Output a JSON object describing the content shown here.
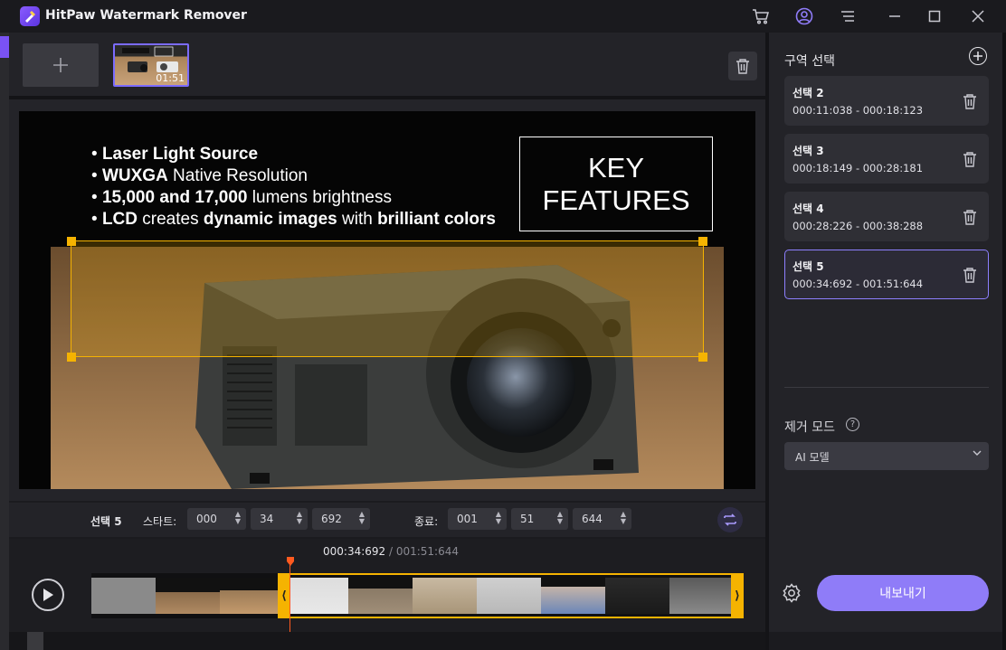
{
  "app": {
    "title": "HitPaw Watermark Remover"
  },
  "media": {
    "thumb_duration": "01:51"
  },
  "video": {
    "bullets": [
      {
        "bold": "Laser Light Source",
        "rest": ""
      },
      {
        "bold": "WUXGA",
        "rest": " Native Resolution"
      },
      {
        "bold": "15,000 and 17,000",
        "rest": " lumens brightness"
      },
      {
        "bold": "LCD",
        "rest": " creates ",
        "bold2": "dynamic images",
        "rest2": " with ",
        "bold3": "brilliant colors"
      }
    ],
    "key_line1": "KEY",
    "key_line2": "FEATURES"
  },
  "controls": {
    "selection_label": "선택 5",
    "start_label": "스타트:",
    "start_h": "000",
    "start_m": "34",
    "start_ms": "692",
    "end_label": "종료:",
    "end_h": "001",
    "end_m": "51",
    "end_ms": "644"
  },
  "timeline": {
    "current": "000:34:692",
    "separator": " / ",
    "total": "001:51:644"
  },
  "right_panel": {
    "title": "구역 선택",
    "selections": [
      {
        "name": "선택 2",
        "range": "000:11:038 - 000:18:123"
      },
      {
        "name": "선택 3",
        "range": "000:18:149 - 000:28:181"
      },
      {
        "name": "선택 4",
        "range": "000:28:226 - 000:38:288"
      },
      {
        "name": "선택 5",
        "range": "000:34:692 - 001:51:644"
      }
    ],
    "mode_title": "제거 모드",
    "mode_value": "AI 모델",
    "export_label": "내보내기"
  },
  "colors": {
    "accent": "#8f7cf8",
    "selection": "#f5b301",
    "playhead": "#ff5a1f"
  }
}
